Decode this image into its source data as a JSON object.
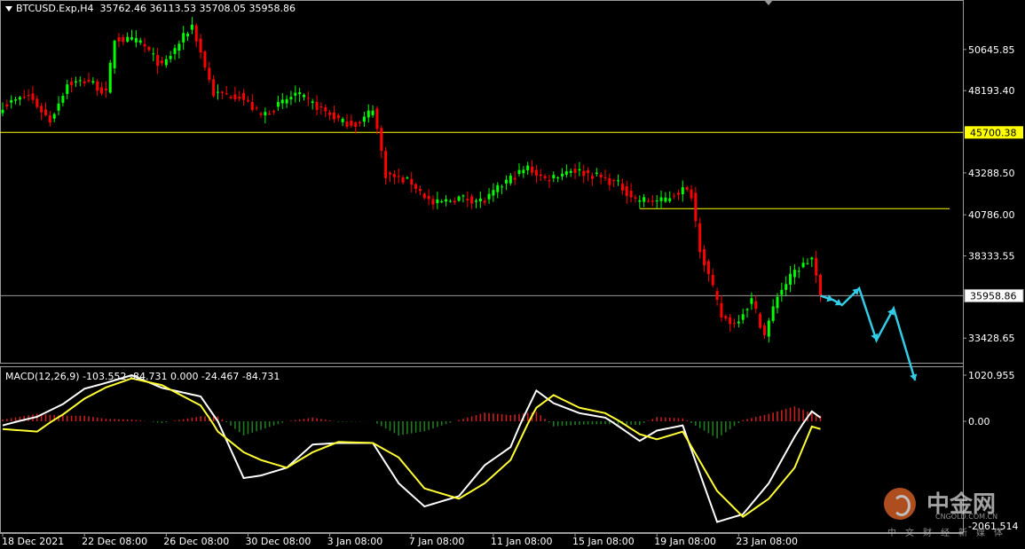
{
  "header": {
    "symbol_info": "BTCUSD.Exp,H4",
    "ohlc": "35762.46 36113.53 35708.05 35958.86"
  },
  "macd": {
    "label": "MACD(12,26,9) -103.552 -84.731 0.000 -24.467 -84.731",
    "axis_top": "1020.955",
    "axis_zero": "0.00",
    "axis_bottom": "-2061.514"
  },
  "watermark": {
    "title": "中金网",
    "url": "CNGOLD.COM.CN",
    "subtitle": "中文财经新媒体"
  },
  "colors": {
    "background": "#000000",
    "bull_candle": "#00ff00",
    "bear_candle": "#ff0000",
    "hline": "#ffff00",
    "price_line": "#9a9a9a",
    "forecast_arrow": "#33cce6",
    "macd_line": "#ffffff",
    "signal_line": "#ffff33",
    "hist_pos": "#c81e1e",
    "hist_neg": "#1e7d1e"
  },
  "chart_data": {
    "type": "candlestick",
    "symbol": "BTCUSD.Exp",
    "timeframe": "H4",
    "price_axis_ticks": [
      50645.85,
      48193.4,
      43288.5,
      40786.0,
      38333.55,
      33428.65
    ],
    "price_axis_tick_labels": [
      "50645.85",
      "48193.40",
      "43288.50",
      "40786.00",
      "38333.55",
      "33428.65"
    ],
    "ylim": [
      31960,
      53600
    ],
    "highlighted_levels": [
      {
        "label": "45700.38",
        "value": 45700.38,
        "color": "#ffff00",
        "style": "line"
      },
      {
        "label": "35958.86",
        "value": 35958.86,
        "color": "#9a9a9a",
        "style": "current price"
      }
    ],
    "support_segment": {
      "value": 41150,
      "from_index": 148,
      "to_index": 220
    },
    "x_tick_labels": [
      "18 Dec 2021",
      "22 Dec 08:00",
      "26 Dec 08:00",
      "30 Dec 08:00",
      "3 Jan 08:00",
      "7 Jan 08:00",
      "11 Jan 08:00",
      "15 Jan 08:00",
      "19 Jan 08:00",
      "23 Jan 08:00"
    ],
    "x_tick_indices": [
      0,
      19,
      38,
      57,
      76,
      95,
      114,
      133,
      152,
      171
    ],
    "anchors": [
      [
        0,
        47300
      ],
      [
        6,
        47900
      ],
      [
        11,
        46400
      ],
      [
        15,
        48600
      ],
      [
        20,
        48800
      ],
      [
        24,
        48000
      ],
      [
        26,
        51300
      ],
      [
        32,
        51100
      ],
      [
        37,
        49600
      ],
      [
        44,
        52100
      ],
      [
        49,
        48000
      ],
      [
        55,
        47900
      ],
      [
        60,
        46700
      ],
      [
        64,
        47300
      ],
      [
        68,
        48000
      ],
      [
        72,
        47400
      ],
      [
        79,
        46300
      ],
      [
        83,
        46200
      ],
      [
        86,
        47200
      ],
      [
        89,
        43200
      ],
      [
        95,
        42700
      ],
      [
        100,
        41400
      ],
      [
        106,
        41800
      ],
      [
        112,
        41600
      ],
      [
        117,
        42800
      ],
      [
        122,
        43600
      ],
      [
        126,
        42900
      ],
      [
        132,
        43500
      ],
      [
        138,
        43100
      ],
      [
        143,
        42600
      ],
      [
        147,
        41700
      ],
      [
        153,
        41600
      ],
      [
        158,
        42300
      ],
      [
        160,
        42000
      ],
      [
        162,
        38800
      ],
      [
        167,
        34700
      ],
      [
        170,
        34300
      ],
      [
        174,
        35700
      ],
      [
        177,
        33600
      ],
      [
        180,
        36000
      ],
      [
        184,
        37400
      ],
      [
        188,
        38200
      ],
      [
        190,
        35959
      ]
    ],
    "forecast_path": [
      [
        190,
        35959
      ],
      [
        193,
        35700
      ],
      [
        195,
        35400
      ],
      [
        199,
        36400
      ],
      [
        203,
        33300
      ],
      [
        207,
        35200
      ],
      [
        212,
        30900
      ]
    ],
    "macd_lines": {
      "macd": [
        [
          0,
          -80
        ],
        [
          8,
          100
        ],
        [
          14,
          380
        ],
        [
          19,
          720
        ],
        [
          24,
          850
        ],
        [
          30,
          1020
        ],
        [
          37,
          740
        ],
        [
          46,
          550
        ],
        [
          50,
          0
        ],
        [
          56,
          -1100
        ],
        [
          60,
          -1050
        ],
        [
          66,
          -900
        ],
        [
          72,
          -450
        ],
        [
          78,
          -420
        ],
        [
          86,
          -420
        ],
        [
          92,
          -1200
        ],
        [
          98,
          -1650
        ],
        [
          106,
          -1450
        ],
        [
          112,
          -850
        ],
        [
          118,
          -500
        ],
        [
          124,
          680
        ],
        [
          128,
          400
        ],
        [
          134,
          180
        ],
        [
          140,
          80
        ],
        [
          148,
          -380
        ],
        [
          152,
          -180
        ],
        [
          158,
          -80
        ],
        [
          166,
          -1950
        ],
        [
          172,
          -1800
        ],
        [
          178,
          -1200
        ],
        [
          184,
          -300
        ],
        [
          188,
          220
        ],
        [
          190,
          80
        ]
      ],
      "signal": [
        [
          0,
          -150
        ],
        [
          8,
          -200
        ],
        [
          14,
          150
        ],
        [
          19,
          500
        ],
        [
          24,
          750
        ],
        [
          30,
          950
        ],
        [
          37,
          800
        ],
        [
          46,
          350
        ],
        [
          50,
          -200
        ],
        [
          56,
          -600
        ],
        [
          60,
          -750
        ],
        [
          66,
          -900
        ],
        [
          72,
          -600
        ],
        [
          78,
          -400
        ],
        [
          86,
          -420
        ],
        [
          92,
          -700
        ],
        [
          98,
          -1300
        ],
        [
          106,
          -1500
        ],
        [
          112,
          -1200
        ],
        [
          118,
          -750
        ],
        [
          124,
          300
        ],
        [
          128,
          580
        ],
        [
          134,
          300
        ],
        [
          140,
          180
        ],
        [
          148,
          -250
        ],
        [
          152,
          -350
        ],
        [
          158,
          -200
        ],
        [
          166,
          -1350
        ],
        [
          172,
          -1850
        ],
        [
          178,
          -1500
        ],
        [
          184,
          -900
        ],
        [
          188,
          -100
        ],
        [
          190,
          -150
        ]
      ],
      "ylim": [
        -2061.514,
        1020.955
      ]
    }
  }
}
